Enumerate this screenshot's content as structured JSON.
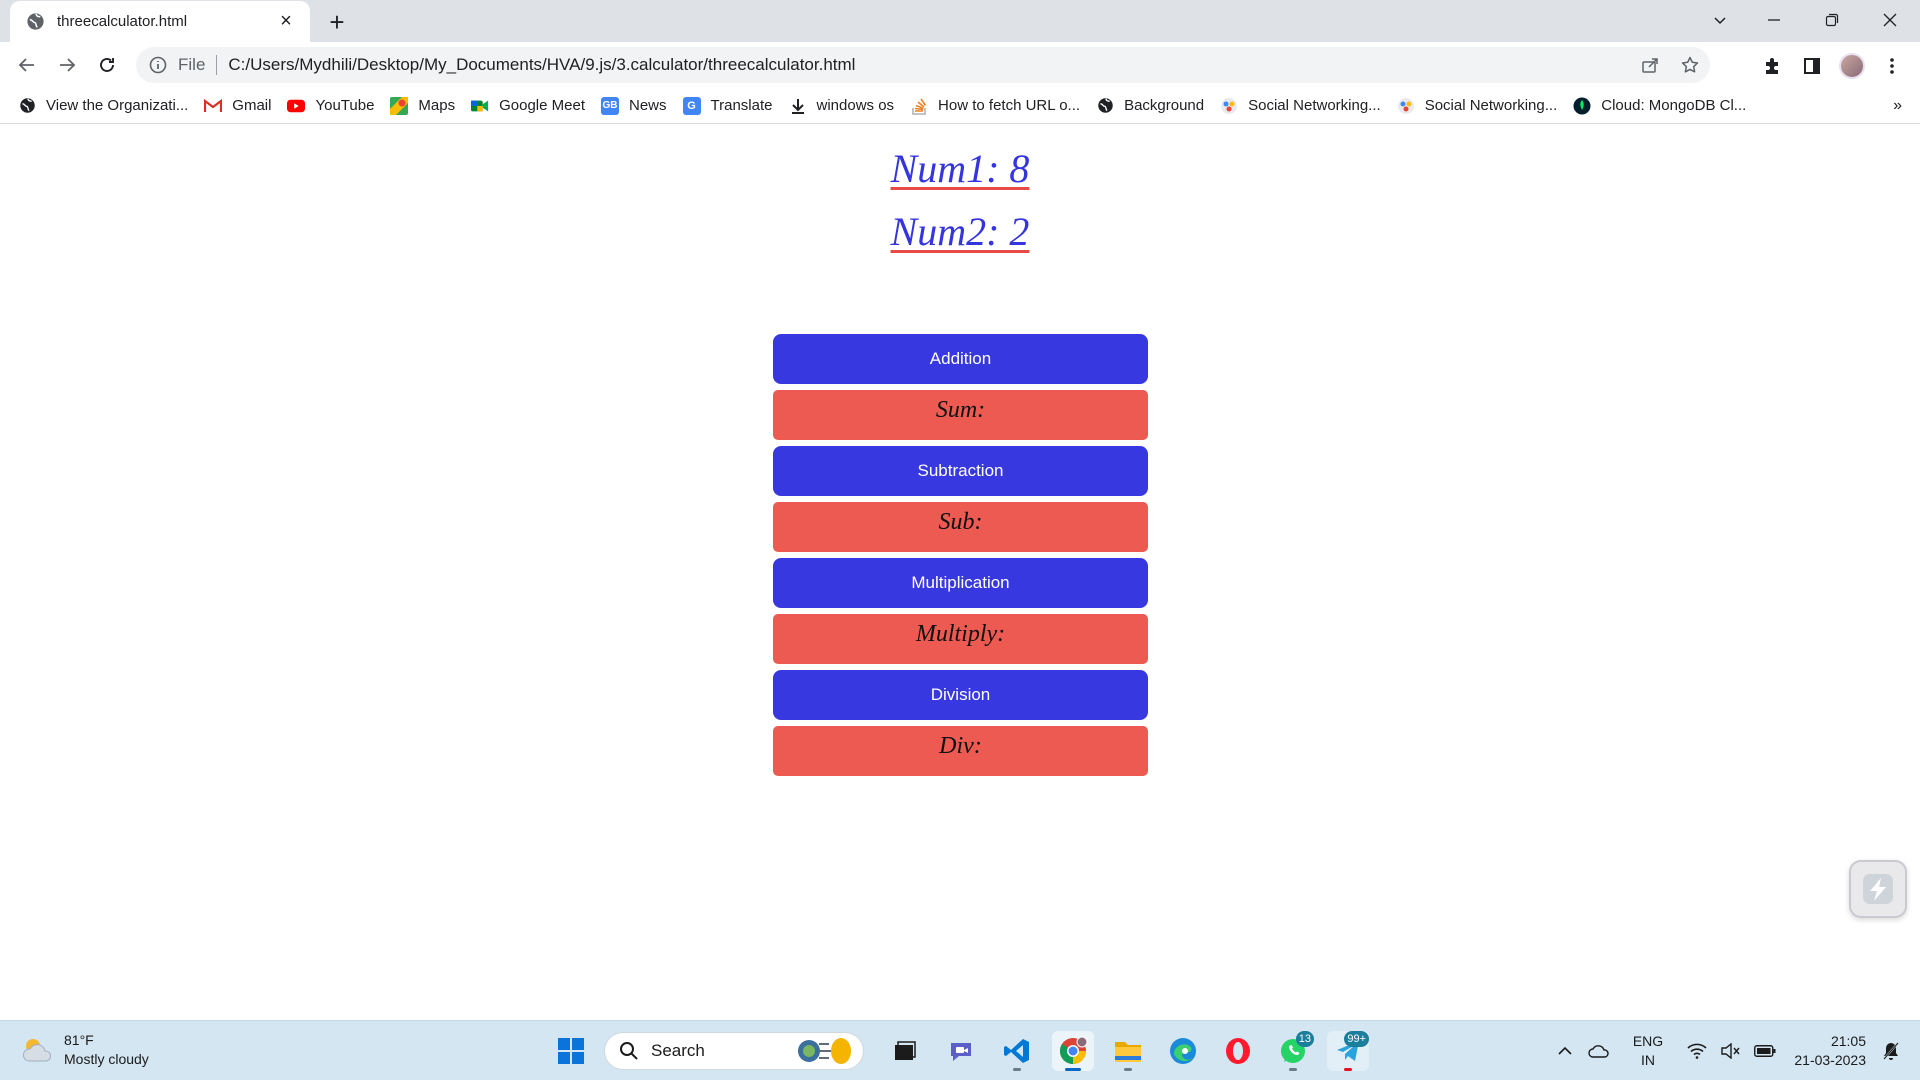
{
  "browser": {
    "tab_title": "threecalculator.html",
    "url_scheme": "File",
    "url": "C:/Users/Mydhili/Desktop/My_Documents/HVA/9.js/3.calculator/threecalculator.html",
    "bookmarks": [
      {
        "label": "View the Organizati...",
        "icon": "globe-icon"
      },
      {
        "label": "Gmail",
        "icon": "gmail-icon"
      },
      {
        "label": "YouTube",
        "icon": "youtube-icon"
      },
      {
        "label": "Maps",
        "icon": "maps-icon"
      },
      {
        "label": "Google Meet",
        "icon": "meet-icon"
      },
      {
        "label": "News",
        "icon": "news-icon"
      },
      {
        "label": "Translate",
        "icon": "translate-icon"
      },
      {
        "label": "windows os",
        "icon": "download-icon"
      },
      {
        "label": "How to fetch URL o...",
        "icon": "stackoverflow-icon"
      },
      {
        "label": "Background",
        "icon": "globe-icon"
      },
      {
        "label": "Social Networking...",
        "icon": "social-icon"
      },
      {
        "label": "Social Networking...",
        "icon": "social-icon"
      },
      {
        "label": "Cloud: MongoDB Cl...",
        "icon": "mongodb-icon"
      }
    ],
    "bookmarks_more": "»"
  },
  "page": {
    "num1_text": "Num1: 8",
    "num2_text": "Num2: 2",
    "operations": [
      {
        "button": "Addition",
        "result": "Sum:"
      },
      {
        "button": "Subtraction",
        "result": "Sub:"
      },
      {
        "button": "Multiplication",
        "result": "Multiply:"
      },
      {
        "button": "Division",
        "result": "Div:"
      }
    ]
  },
  "taskbar": {
    "weather_temp": "81°F",
    "weather_desc": "Mostly cloudy",
    "search_label": "Search",
    "whatsapp_badge": "13",
    "telegram_badge": "99+",
    "lang_line1": "ENG",
    "lang_line2": "IN",
    "time": "21:05",
    "date": "21-03-2023"
  },
  "colors": {
    "button_blue": "#3838e0",
    "result_red": "#ec5a52",
    "heading_blue": "#3535e0",
    "underline_red": "#e84a4a"
  }
}
